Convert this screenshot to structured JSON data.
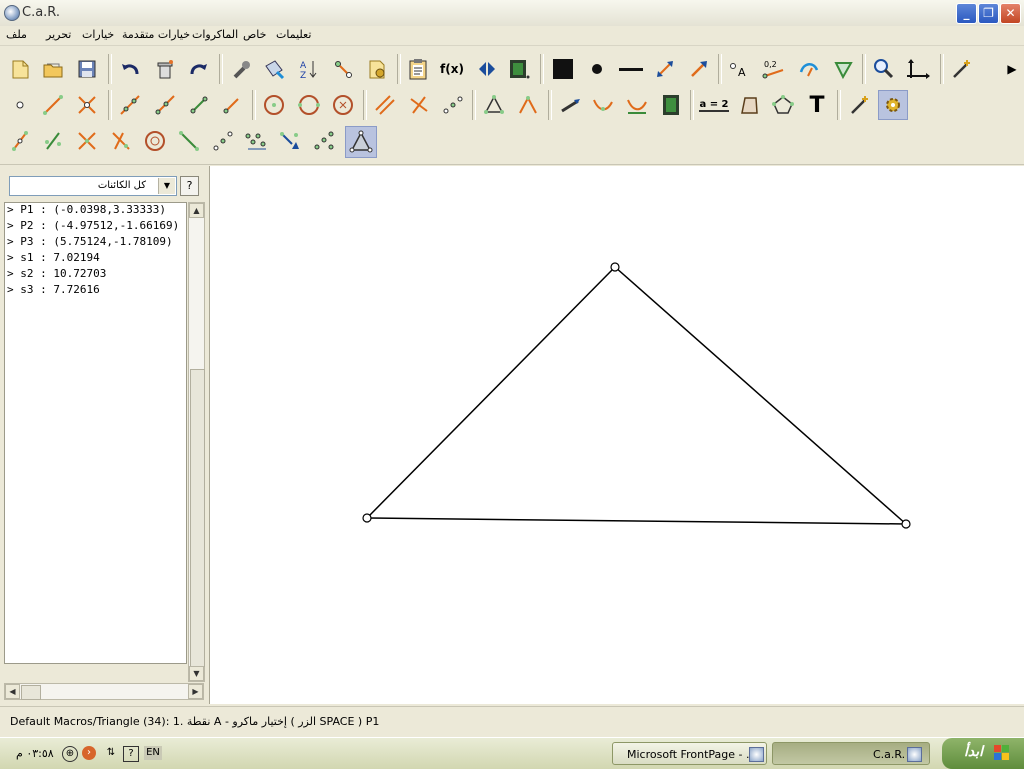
{
  "window": {
    "title": "C.a.R."
  },
  "menu": [
    "ملف",
    "تحرير",
    "خيارات",
    "خيارات متقدمة",
    "الماكروات",
    "خاص",
    "تعليمات"
  ],
  "left_panel": {
    "filter_label": "كل الكائنات",
    "help_label": "?",
    "objects": [
      "> P1 : (-0.0398,3.33333)",
      "> P2 : (-4.97512,-1.66169)",
      "> P3 : (5.75124,-1.78109)",
      "> s1 : 7.02194",
      "> s2 : 10.72703",
      "> s3 : 7.72616"
    ]
  },
  "toolbar": {
    "fx_label": "f(x)",
    "coord_label": "0,2",
    "label_A": "A",
    "assign_label": "a = 2",
    "text_label": "T",
    "more_arrow": "▶"
  },
  "status": {
    "text": "Default Macros/Triangle (34): 1. نقطة A - إختيار ماكرو ( الزر SPACE ) P1"
  },
  "taskbar": {
    "clock": "٠٣:٥٨ م",
    "lang": "EN",
    "tasks": [
      {
        "label": "Microsoft FrontPage - ..."
      },
      {
        "label": "C.a.R."
      }
    ],
    "start_label": "ابدأ"
  },
  "colors": {
    "point_fill": "#ffffff",
    "segment": "#000000",
    "selected_tool": "#b9c3df"
  }
}
